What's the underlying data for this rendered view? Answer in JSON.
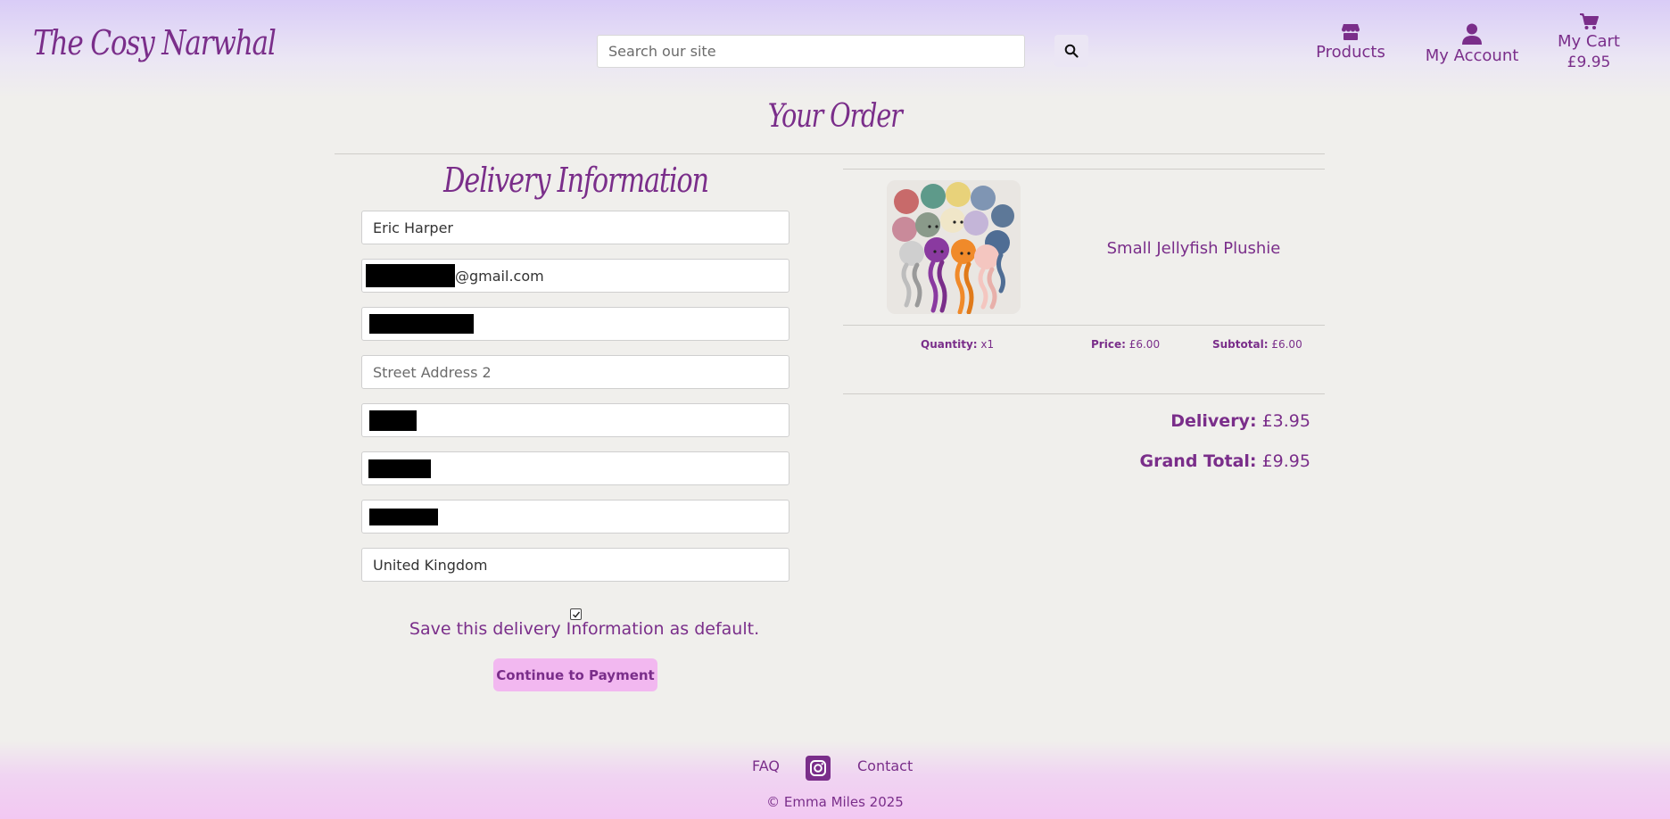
{
  "header": {
    "logo": "The Cosy Narwhal",
    "search": {
      "placeholder": "Search our site",
      "icon": "search-icon"
    },
    "nav": {
      "products": {
        "label": "Products",
        "icon": "store-icon"
      },
      "account": {
        "label": "My Account",
        "icon": "user-icon"
      },
      "cart": {
        "label": "My Cart",
        "total": "£9.95",
        "icon": "cart-icon"
      }
    }
  },
  "page_title": "Your Order",
  "delivery": {
    "title": "Delivery Information",
    "fields": {
      "full_name": "Eric Harper",
      "email_suffix": "@gmail.com",
      "street_address_2_placeholder": "Street Address 2",
      "country": "United Kingdom"
    },
    "save_checked": true,
    "save_label": "Save this delivery Information as default.",
    "continue_label": "Continue to Payment"
  },
  "order": {
    "item": {
      "name": "Small Jellyfish Plushie",
      "quantity_label": "Quantity:",
      "quantity": "x1",
      "price_label": "Price:",
      "price": "£6.00",
      "subtotal_label": "Subtotal:",
      "subtotal": "£6.00"
    },
    "delivery_label": "Delivery:",
    "delivery_value": "£3.95",
    "grand_total_label": "Grand Total:",
    "grand_total_value": "£9.95"
  },
  "footer": {
    "faq": "FAQ",
    "contact": "Contact",
    "social_icon": "instagram-icon",
    "copyright": "© Emma Miles 2025"
  },
  "colors": {
    "brand": "#7a2e8a",
    "button_bg": "#f2b8f0",
    "page_bg": "#f0efec"
  }
}
